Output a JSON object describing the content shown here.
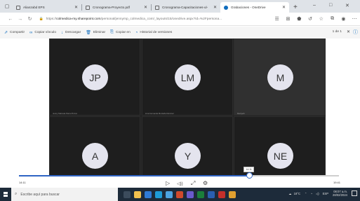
{
  "browser": {
    "tabs": [
      {
        "label": "Alianzabd EPS",
        "favicon": "page-icon",
        "active": false
      },
      {
        "label": "Cronograma-Proyecto.pdf",
        "favicon": "page-icon",
        "active": false
      },
      {
        "label": "Cronograma-Capacitaciones-ul-",
        "favicon": "page-icon",
        "active": false
      },
      {
        "label": "Grabaciones - OneDrive",
        "favicon": "cloud-icon",
        "active": true
      }
    ],
    "new_tab": "+",
    "window_controls": {
      "minimize": "–",
      "maximize": "□",
      "close": "✕"
    },
    "url_prefix": "https://",
    "url_host": "colmedica-my.sharepoint.com",
    "url_rest": "/personal/jennymp_colmedica_com/_layouts/15/onedrive.aspx?id=%2Fpersona..."
  },
  "commands": [
    {
      "icon": "share-icon",
      "label": "Compartir"
    },
    {
      "icon": "link-icon",
      "label": "Copiar vínculo"
    },
    {
      "icon": "download-icon",
      "label": "Descargar"
    },
    {
      "icon": "delete-icon",
      "label": "Eliminar"
    },
    {
      "icon": "copy-icon",
      "label": "Copiar en"
    },
    {
      "icon": "history-icon",
      "label": "Historial de versiones"
    }
  ],
  "pager": "1 de 1",
  "participants": [
    {
      "initials": "JP",
      "name": "Jenny Marcela Parra Pinzon",
      "highlighted": false
    },
    {
      "initials": "LM",
      "name": "Lina Fernanda Montaña Ramirez",
      "highlighted": false
    },
    {
      "initials": "M",
      "name": "Marlyeth",
      "highlighted": true
    },
    {
      "initials": "A",
      "name": "",
      "highlighted": false
    },
    {
      "initials": "Y",
      "name": "",
      "highlighted": false
    },
    {
      "initials": "NE",
      "name": "",
      "highlighted": false
    }
  ],
  "player": {
    "current_time": "14:11",
    "tooltip_time": "14:11",
    "total_time": "19:41",
    "progress_fraction": 0.72
  },
  "taskbar": {
    "search_placeholder": "Escribe aquí para buscar",
    "weather": "18°C",
    "time": "08:07 a.m.",
    "date": "28/02/2024",
    "language": "ESP"
  }
}
